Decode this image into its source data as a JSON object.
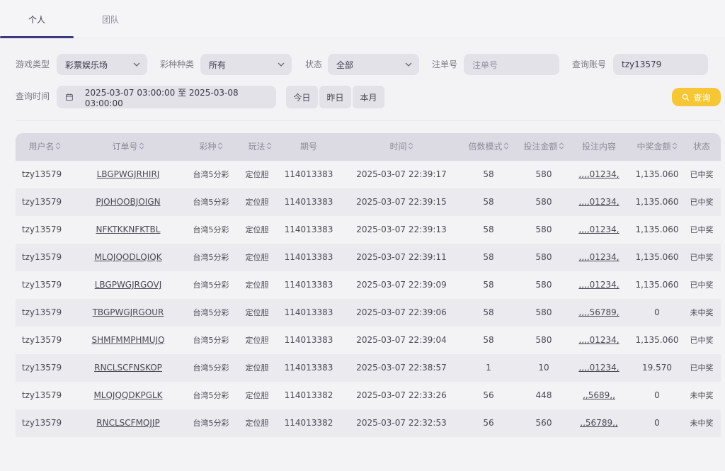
{
  "tabs": [
    {
      "label": "个人",
      "active": true
    },
    {
      "label": "团队",
      "active": false
    }
  ],
  "filters": {
    "game_type_label": "游戏类型",
    "game_type_value": "彩票娱乐场",
    "lottery_kind_label": "彩种种类",
    "lottery_kind_value": "所有",
    "status_label": "状态",
    "status_value": "全部",
    "order_no_label": "注单号",
    "order_no_placeholder": "注单号",
    "account_label": "查询账号",
    "account_value": "tzy13579",
    "time_label": "查询时间",
    "time_range": "2025-03-07 03:00:00 至 2025-03-08 03:00:00",
    "quick": [
      "今日",
      "昨日",
      "本月"
    ],
    "search_label": "查询"
  },
  "table": {
    "columns": [
      "用户名",
      "订单号",
      "彩种",
      "玩法",
      "期号",
      "时间",
      "倍数模式",
      "投注金额",
      "投注内容",
      "中奖金额",
      "状态"
    ],
    "rows": [
      [
        "tzy13579",
        "LBGPWGJRHIRJ",
        "台湾5分彩",
        "定位胆",
        "114013383",
        "2025-03-07 22:39:17",
        "58",
        "580",
        ",,,,01234,",
        "1,135.060",
        "已中奖"
      ],
      [
        "tzy13579",
        "PJOHOOBJOIGN",
        "台湾5分彩",
        "定位胆",
        "114013383",
        "2025-03-07 22:39:15",
        "58",
        "580",
        ",,,,01234,",
        "1,135.060",
        "已中奖"
      ],
      [
        "tzy13579",
        "NFKTKKNFKTBL",
        "台湾5分彩",
        "定位胆",
        "114013383",
        "2025-03-07 22:39:13",
        "58",
        "580",
        ",,,,01234,",
        "1,135.060",
        "已中奖"
      ],
      [
        "tzy13579",
        "MLQJQODLQIQK",
        "台湾5分彩",
        "定位胆",
        "114013383",
        "2025-03-07 22:39:11",
        "58",
        "580",
        ",,,,01234,",
        "1,135.060",
        "已中奖"
      ],
      [
        "tzy13579",
        "LBGPWGJRGOVJ",
        "台湾5分彩",
        "定位胆",
        "114013383",
        "2025-03-07 22:39:09",
        "58",
        "580",
        ",,,,01234,",
        "1,135.060",
        "已中奖"
      ],
      [
        "tzy13579",
        "TBGPWGJRGOUR",
        "台湾5分彩",
        "定位胆",
        "114013383",
        "2025-03-07 22:39:06",
        "58",
        "580",
        ",,,,56789,",
        "0",
        "未中奖"
      ],
      [
        "tzy13579",
        "SHMFMMPHMUJQ",
        "台湾5分彩",
        "定位胆",
        "114013383",
        "2025-03-07 22:39:04",
        "58",
        "580",
        ",,,,01234,",
        "1,135.060",
        "已中奖"
      ],
      [
        "tzy13579",
        "RNCLSCFNSKOP",
        "台湾5分彩",
        "定位胆",
        "114013383",
        "2025-03-07 22:38:57",
        "1",
        "10",
        ",,,,01234,",
        "19.570",
        "已中奖"
      ],
      [
        "tzy13579",
        "MLQJQQDKPGLK",
        "台湾5分彩",
        "定位胆",
        "114013382",
        "2025-03-07 22:33:26",
        "56",
        "448",
        ",,5689,,",
        "0",
        "未中奖"
      ],
      [
        "tzy13579",
        "RNCLSCFMQJJP",
        "台湾5分彩",
        "定位胆",
        "114013382",
        "2025-03-07 22:32:53",
        "56",
        "560",
        ",,56789,,",
        "0",
        "未中奖"
      ]
    ]
  },
  "colors": {
    "accent": "#3a3880",
    "search_button": "#f7c634"
  },
  "icons": {
    "sort": "sort-icon",
    "calendar": "calendar-icon",
    "search": "search-icon",
    "chevron": "chevron-down-icon"
  }
}
